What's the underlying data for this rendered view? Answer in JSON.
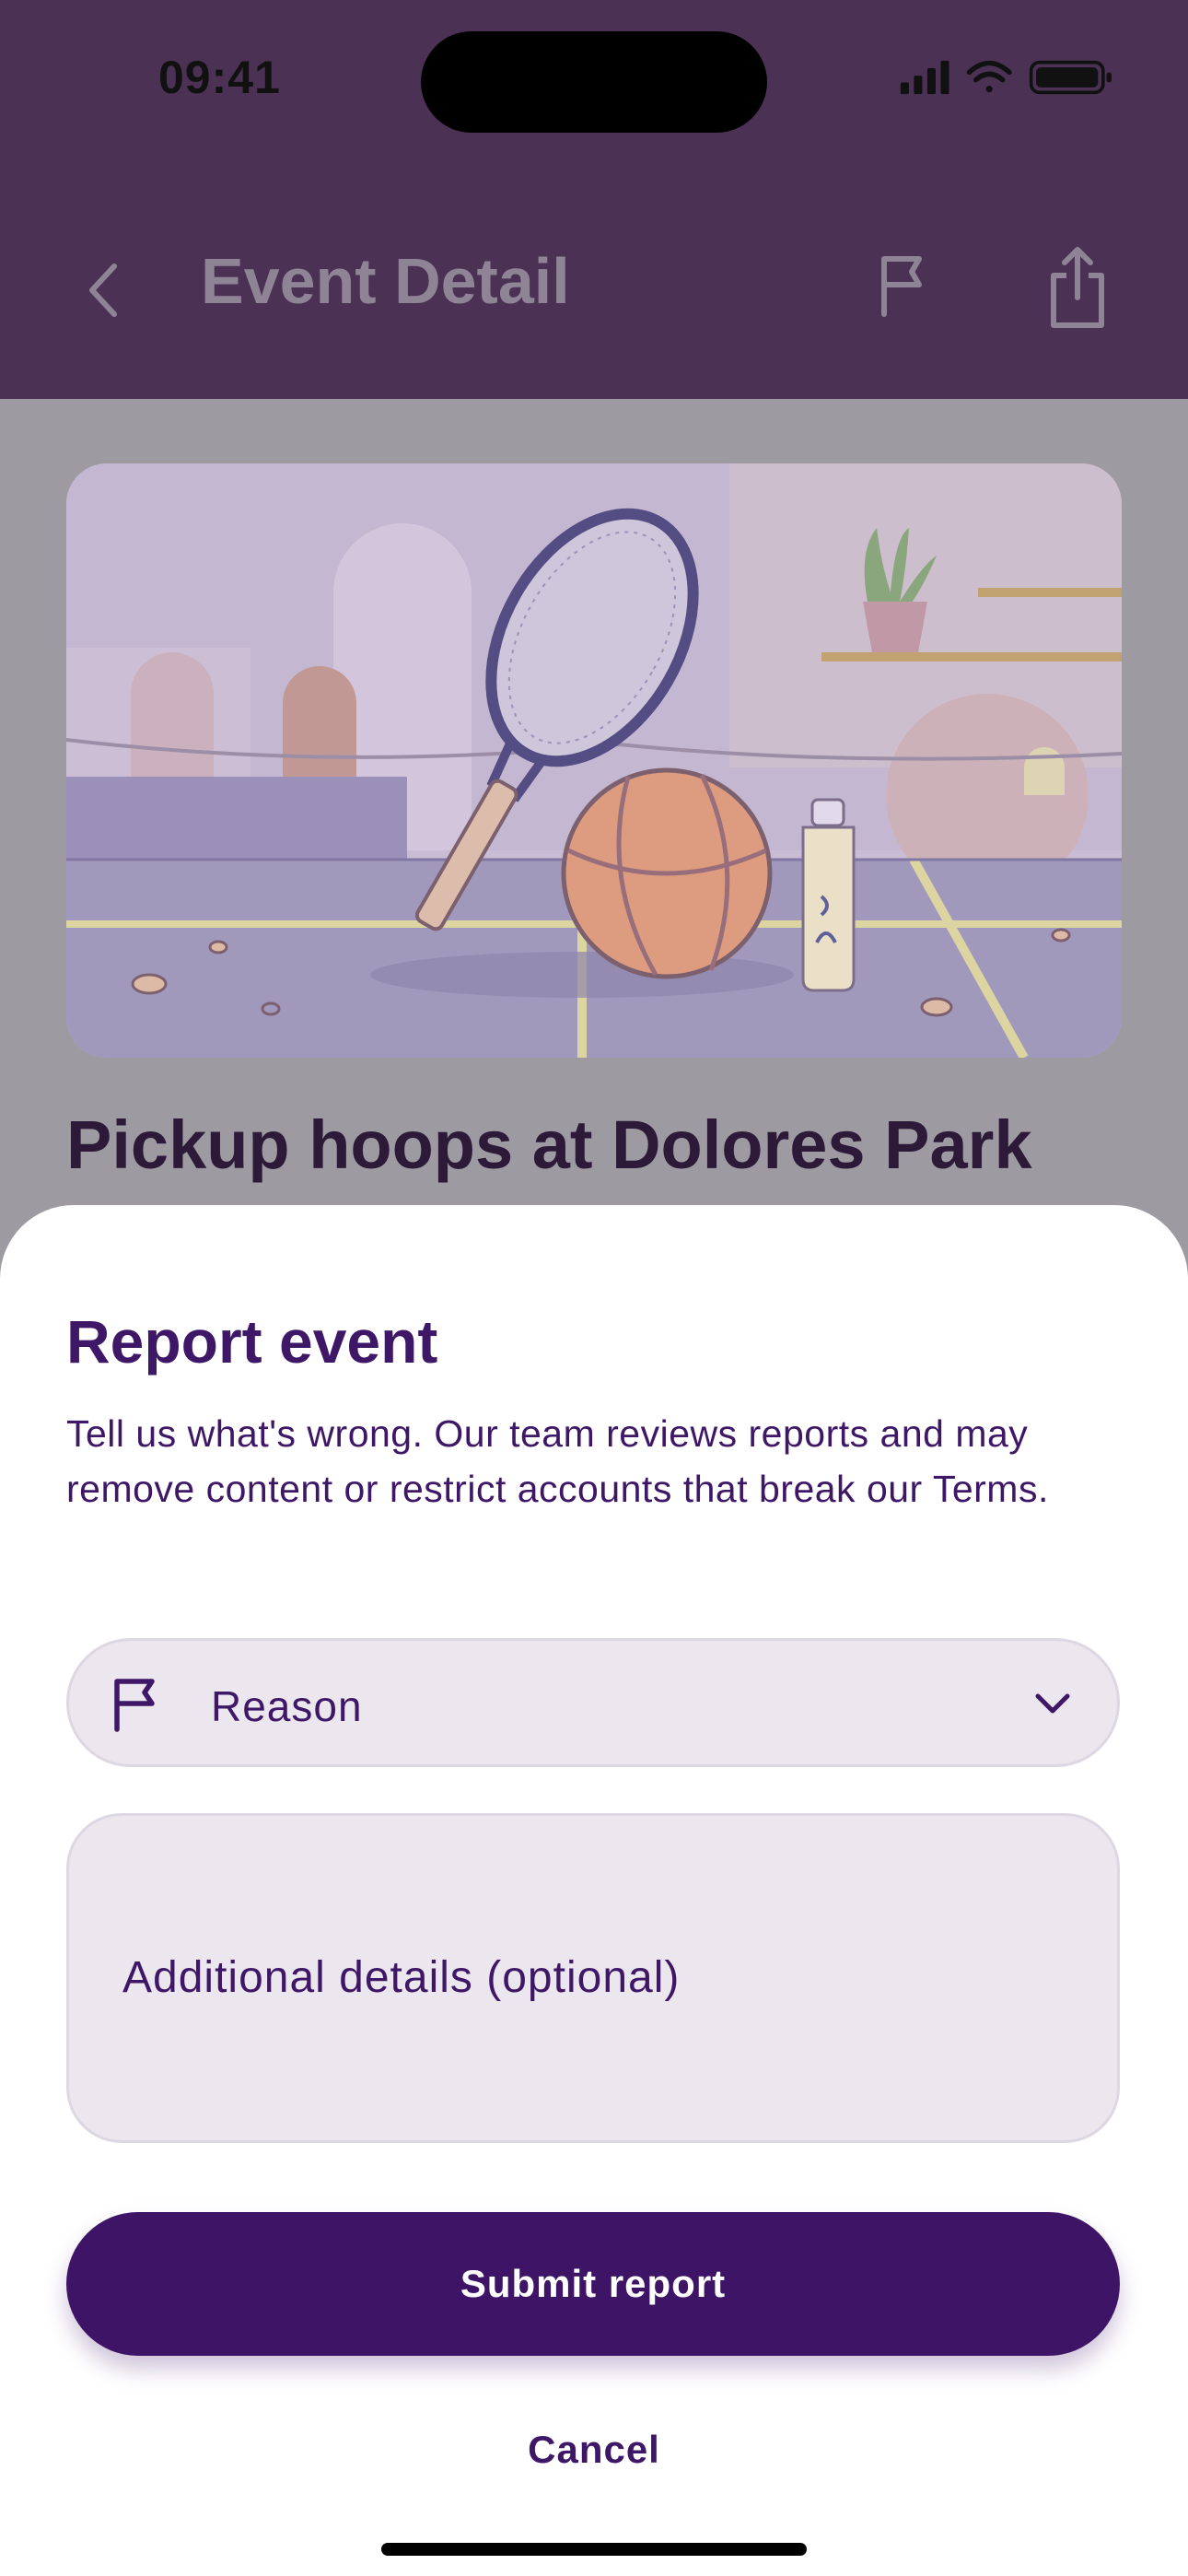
{
  "status_bar": {
    "time": "09:41"
  },
  "nav": {
    "title": "Event Detail"
  },
  "event": {
    "title": "Pickup hoops at Dolores Park"
  },
  "report_sheet": {
    "title": "Report event",
    "description": "Tell us what's wrong. Our team reviews reports and may remove content or restrict accounts that break our Terms.",
    "reason_label": "Reason",
    "details_placeholder": "Additional details (optional)",
    "submit_label": "Submit report",
    "cancel_label": "Cancel"
  },
  "colors": {
    "accent": "#3e1466",
    "header": "#4b3254",
    "field_bg": "#ece6ef"
  },
  "icons": [
    "back-chevron-icon",
    "flag-icon",
    "share-icon",
    "signal-icon",
    "wifi-icon",
    "battery-icon",
    "chevron-down-icon"
  ]
}
